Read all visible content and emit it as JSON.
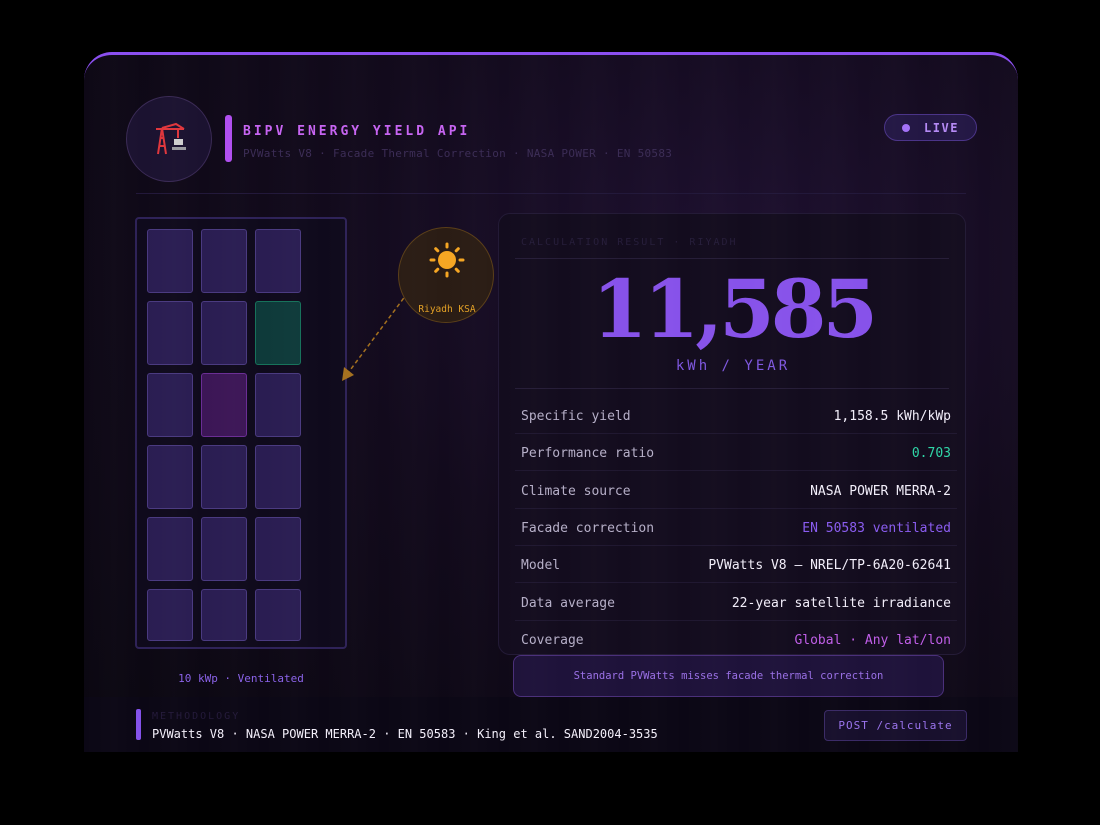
{
  "header": {
    "title": "BIPV ENERGY YIELD API",
    "subtitle": "PVWatts V8 · Facade Thermal Correction · NASA POWER · EN 50583",
    "status_badge": "LIVE",
    "logo_icon": "crane-icon"
  },
  "building": {
    "caption": "10 kWp · Ventilated",
    "panel_rows": [
      [
        "violet",
        "violet",
        "violet"
      ],
      [
        "violet",
        "violet",
        "green"
      ],
      [
        "violet",
        "magenta",
        "violet"
      ],
      [
        "violet",
        "violet",
        "violet"
      ],
      [
        "violet",
        "violet",
        "violet"
      ],
      [
        "violet",
        "violet",
        "violet"
      ]
    ]
  },
  "sun": {
    "icon": "sun-icon",
    "location": "Riyadh KSA"
  },
  "result": {
    "label": "CALCULATION RESULT · RIYADH",
    "value": "11,585",
    "unit": "kWh / YEAR",
    "rows": [
      {
        "key": "Specific yield",
        "value": "1,158.5 kWh/kWp",
        "color": "#f2eefa"
      },
      {
        "key": "Performance ratio",
        "value": "0.703",
        "color": "#2fd6a8"
      },
      {
        "key": "Climate source",
        "value": "NASA POWER MERRA-2",
        "color": "#f2eefa"
      },
      {
        "key": "Facade correction",
        "value": "EN 50583 ventilated",
        "color": "#8a5cf0"
      },
      {
        "key": "Model",
        "value": "PVWatts V8 — NREL/TP-6A20-62641",
        "color": "#f2eefa"
      },
      {
        "key": "Data average",
        "value": "22-year satellite irradiance",
        "color": "#f2eefa"
      },
      {
        "key": "Coverage",
        "value": "Global · Any lat/lon",
        "color": "#c05ee8"
      }
    ]
  },
  "tooltip": "Standard PVWatts misses facade thermal correction",
  "footer": {
    "label": "METHODOLOGY",
    "text": "PVWatts V8 · NASA POWER MERRA-2 · EN 50583 · King et al. SAND2004-3535",
    "button": "POST /calculate"
  },
  "colors": {
    "accent": "#8752ea",
    "title": "#c764f2",
    "sun": "#f5a623",
    "green": "#2fd6a8"
  }
}
